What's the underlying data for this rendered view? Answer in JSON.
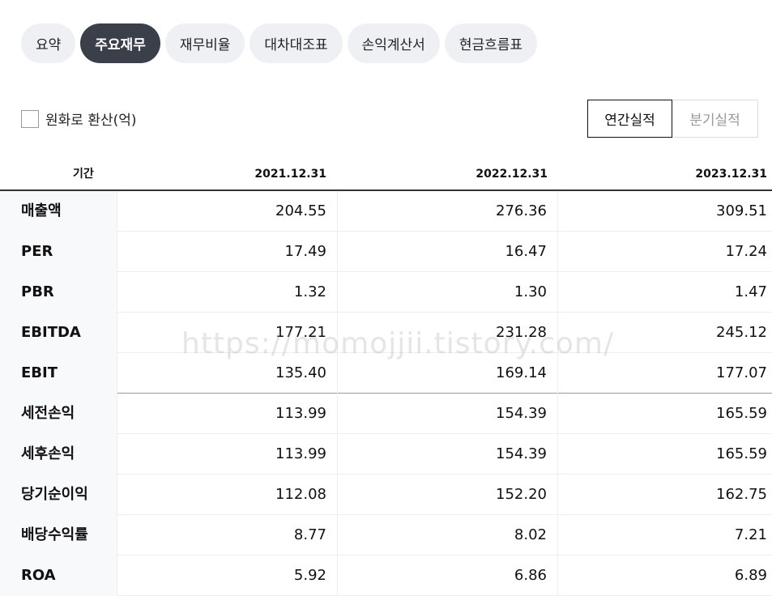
{
  "tabs": [
    {
      "label": "요약",
      "active": false
    },
    {
      "label": "주요재무",
      "active": true
    },
    {
      "label": "재무비율",
      "active": false
    },
    {
      "label": "대차대조표",
      "active": false
    },
    {
      "label": "손익계산서",
      "active": false
    },
    {
      "label": "현금흐름표",
      "active": false
    }
  ],
  "options": {
    "krw_label": "원화로 환산(억)",
    "krw_checked": false,
    "annual_label": "연간실적",
    "quarter_label": "분기실적",
    "selected_period": "연간실적"
  },
  "table": {
    "headers": [
      "기간",
      "2021.12.31",
      "2022.12.31",
      "2023.12.31"
    ],
    "rows": [
      {
        "label": "매출액",
        "values": [
          "204.55",
          "276.36",
          "309.51"
        ]
      },
      {
        "label": "PER",
        "values": [
          "17.49",
          "16.47",
          "17.24"
        ]
      },
      {
        "label": "PBR",
        "values": [
          "1.32",
          "1.30",
          "1.47"
        ]
      },
      {
        "label": "EBITDA",
        "values": [
          "177.21",
          "231.28",
          "245.12"
        ]
      },
      {
        "label": "EBIT",
        "values": [
          "135.40",
          "169.14",
          "177.07"
        ]
      },
      {
        "label": "세전손익",
        "values": [
          "113.99",
          "154.39",
          "165.59"
        ]
      },
      {
        "label": "세후손익",
        "values": [
          "113.99",
          "154.39",
          "165.59"
        ]
      },
      {
        "label": "당기순이익",
        "values": [
          "112.08",
          "152.20",
          "162.75"
        ]
      },
      {
        "label": "배당수익률",
        "values": [
          "8.77",
          "8.02",
          "7.21"
        ]
      },
      {
        "label": "ROA",
        "values": [
          "5.92",
          "6.86",
          "6.89"
        ]
      }
    ]
  },
  "watermark": "https://momojjii.tistory.com/"
}
